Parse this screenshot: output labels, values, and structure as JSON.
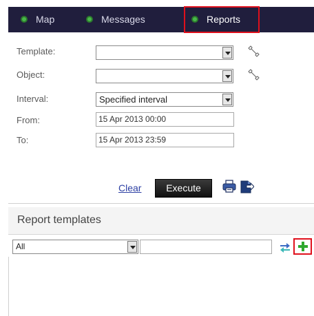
{
  "nav": {
    "tabs": [
      {
        "label": "Map",
        "active": false
      },
      {
        "label": "Messages",
        "active": false
      },
      {
        "label": "Reports",
        "active": true
      }
    ]
  },
  "form": {
    "template_label": "Template:",
    "template_value": "",
    "object_label": "Object:",
    "object_value": "",
    "interval_label": "Interval:",
    "interval_value": "Specified interval",
    "from_label": "From:",
    "from_value": "15 Apr 2013 00:00",
    "to_label": "To:",
    "to_value": "15 Apr 2013 23:59"
  },
  "actions": {
    "clear_label": "Clear",
    "execute_label": "Execute"
  },
  "report_templates": {
    "title": "Report templates",
    "filter_value": "All",
    "search_value": ""
  },
  "colors": {
    "nav_bg": "#201e3d",
    "highlight": "#e0101c",
    "accent_green": "#49b84a"
  },
  "icons": {
    "template_config": "wrench-icon",
    "object_config": "wrench-icon",
    "print": "printer-icon",
    "export": "export-icon",
    "swap": "swap-arrows-icon",
    "add": "plus-icon"
  }
}
